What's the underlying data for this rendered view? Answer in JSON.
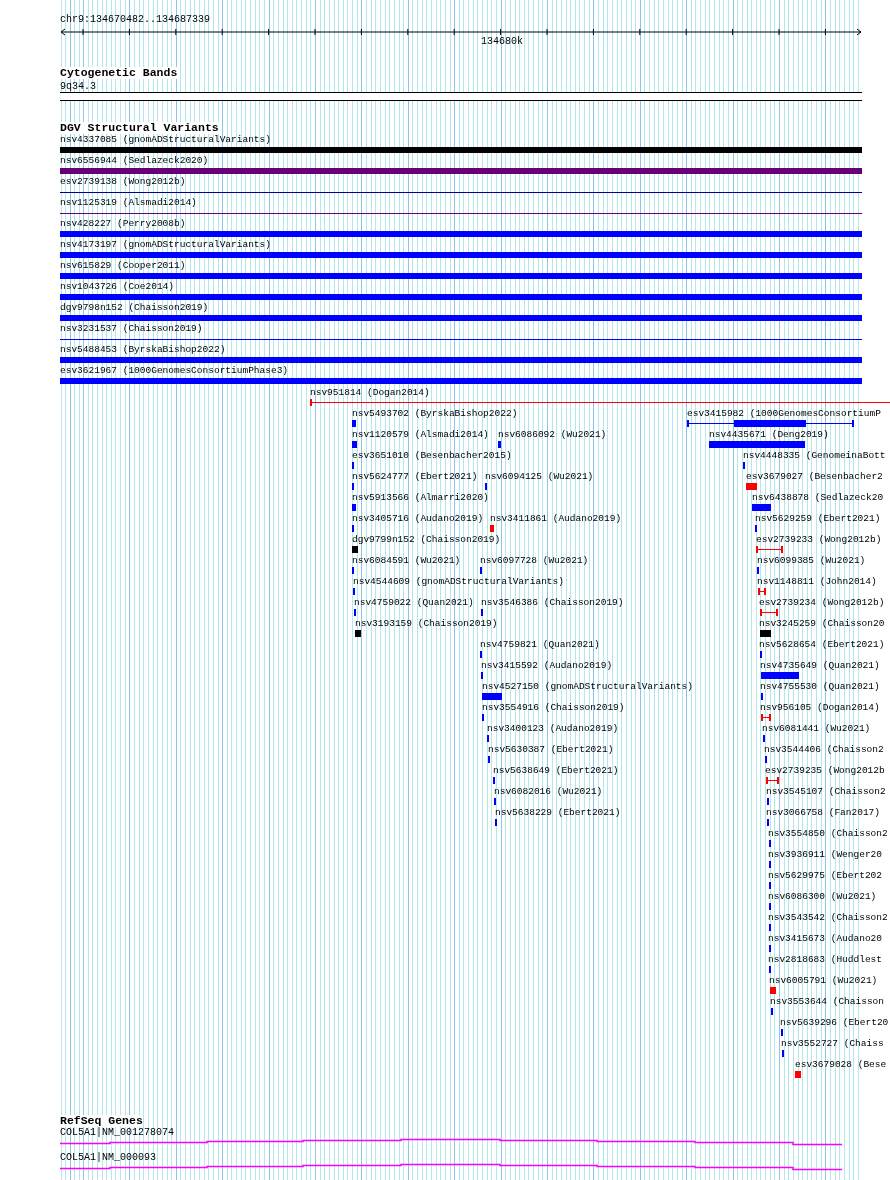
{
  "ruler": {
    "range": "chr9:134670482..134687339",
    "tick_label": "134680k"
  },
  "cytogenetic_bands": {
    "title": "Cytogenetic Bands",
    "band": "9q34.3"
  },
  "dgv": {
    "title": "DGV Structural Variants",
    "full_width": [
      {
        "label": "nsv4337085 (gnomADStructuralVariants)",
        "color": "#000000",
        "kind": "thick"
      },
      {
        "label": "nsv6556944 (Sedlazeck2020)",
        "color": "#660077",
        "kind": "thick"
      },
      {
        "label": "esv2739138 (Wong2012b)",
        "color": "#000099",
        "kind": "thin"
      },
      {
        "label": "nsv1125319 (Alsmadi2014)",
        "color": "#660077",
        "kind": "thin"
      },
      {
        "label": "nsv428227 (Perry2008b)",
        "color": "#0000ff",
        "kind": "thick"
      },
      {
        "label": "nsv4173197 (gnomADStructuralVariants)",
        "color": "#0000ff",
        "kind": "thick"
      },
      {
        "label": "nsv615829 (Cooper2011)",
        "color": "#0000ff",
        "kind": "thick"
      },
      {
        "label": "nsv1043726 (Coe2014)",
        "color": "#0000ff",
        "kind": "thick"
      },
      {
        "label": "dgv9798n152 (Chaisson2019)",
        "color": "#0000ff",
        "kind": "thick"
      },
      {
        "label": "nsv3231537 (Chaisson2019)",
        "color": "#0000ff",
        "kind": "thin"
      },
      {
        "label": "nsv5488453 (ByrskaBishop2022)",
        "color": "#0000ff",
        "kind": "thick"
      },
      {
        "label": "esv3621967 (1000GenomesConsortiumPhase3)",
        "color": "#0000ff",
        "kind": "thick"
      }
    ],
    "variants": [
      {
        "label": "nsv951814 (Dogan2014)",
        "color": "#ff0000",
        "kind": "span"
      },
      {
        "label": "nsv5493702 (ByrskaBishop2022)",
        "color": "#0000ff",
        "kind": "block"
      },
      {
        "label": "nsv1120579 (Alsmadi2014)",
        "color": "#0000ff",
        "kind": "block"
      },
      {
        "label": "nsv6086092 (Wu2021)",
        "color": "#0000ff",
        "kind": "block"
      },
      {
        "label": "esv3651010 (Besenbacher2015)",
        "color": "#0000ff",
        "kind": "block"
      },
      {
        "label": "nsv5624777 (Ebert2021)",
        "color": "#0000ff",
        "kind": "block"
      },
      {
        "label": "nsv6094125 (Wu2021)",
        "color": "#0000ff",
        "kind": "block"
      },
      {
        "label": "nsv5913566 (Almarri2020)",
        "color": "#0000ff",
        "kind": "block"
      },
      {
        "label": "nsv3405716 (Audano2019)",
        "color": "#0000ff",
        "kind": "block"
      },
      {
        "label": "nsv3411861 (Audano2019)",
        "color": "#ff0000",
        "kind": "block"
      },
      {
        "label": "dgv9799n152 (Chaisson2019)",
        "color": "#000000",
        "kind": "block"
      },
      {
        "label": "nsv6084591 (Wu2021)",
        "color": "#0000ff",
        "kind": "block"
      },
      {
        "label": "nsv6097728 (Wu2021)",
        "color": "#0000ff",
        "kind": "block"
      },
      {
        "label": "nsv4544609 (gnomADStructuralVariants)",
        "color": "#0000ff",
        "kind": "block"
      },
      {
        "label": "nsv4759022 (Quan2021)",
        "color": "#0000ff",
        "kind": "block"
      },
      {
        "label": "nsv3546386 (Chaisson2019)",
        "color": "#0000ff",
        "kind": "block"
      },
      {
        "label": "nsv3193159 (Chaisson2019)",
        "color": "#000000",
        "kind": "block"
      },
      {
        "label": "nsv4759821 (Quan2021)",
        "color": "#0000ff",
        "kind": "block"
      },
      {
        "label": "nsv3415592 (Audano2019)",
        "color": "#0000ff",
        "kind": "block"
      },
      {
        "label": "nsv4527150 (gnomADStructuralVariants)",
        "color": "#0000ff",
        "kind": "block"
      },
      {
        "label": "nsv3554916 (Chaisson2019)",
        "color": "#0000ff",
        "kind": "block"
      },
      {
        "label": "nsv3400123 (Audano2019)",
        "color": "#0000ff",
        "kind": "block"
      },
      {
        "label": "nsv5630387 (Ebert2021)",
        "color": "#0000ff",
        "kind": "block"
      },
      {
        "label": "nsv5638649 (Ebert2021)",
        "color": "#0000ff",
        "kind": "block"
      },
      {
        "label": "nsv6082016 (Wu2021)",
        "color": "#0000ff",
        "kind": "block"
      },
      {
        "label": "nsv5638229 (Ebert2021)",
        "color": "#0000ff",
        "kind": "block"
      },
      {
        "label": "esv3415982 (1000GenomesConsortiumP",
        "color": "#0000ff",
        "kind": "gapped"
      },
      {
        "label": "nsv4435671 (Deng2019)",
        "color": "#0000ff",
        "kind": "block"
      },
      {
        "label": "nsv4448335 (GenomeinaBott",
        "color": "#0000ff",
        "kind": "block"
      },
      {
        "label": "esv3679027 (Besenbacher2",
        "color": "#ff0000",
        "kind": "block"
      },
      {
        "label": "nsv6438878 (Sedlazeck20",
        "color": "#0000ff",
        "kind": "block"
      },
      {
        "label": "nsv5629259 (Ebert2021)",
        "color": "#0000ff",
        "kind": "block"
      },
      {
        "label": "esv2739233 (Wong2012b)",
        "color": "#ff0000",
        "kind": "span"
      },
      {
        "label": "nsv6099385 (Wu2021)",
        "color": "#0000ff",
        "kind": "block"
      },
      {
        "label": "nsv1148811 (John2014)",
        "color": "#ff0000",
        "kind": "span"
      },
      {
        "label": "esv2739234 (Wong2012b)",
        "color": "#ff0000",
        "kind": "span"
      },
      {
        "label": "nsv3245259 (Chaisson20",
        "color": "#000000",
        "kind": "block"
      },
      {
        "label": "nsv5628654 (Ebert2021)",
        "color": "#0000ff",
        "kind": "block"
      },
      {
        "label": "nsv4735649 (Quan2021)",
        "color": "#0000ff",
        "kind": "block"
      },
      {
        "label": "nsv4755530 (Quan2021)",
        "color": "#0000ff",
        "kind": "block"
      },
      {
        "label": "nsv956105 (Dogan2014)",
        "color": "#ff0000",
        "kind": "span"
      },
      {
        "label": "nsv6081441 (Wu2021)",
        "color": "#0000ff",
        "kind": "block"
      },
      {
        "label": "nsv3544406 (Chaisson2",
        "color": "#0000ff",
        "kind": "block"
      },
      {
        "label": "esv2739235 (Wong2012b",
        "color": "#ff0000",
        "kind": "span"
      },
      {
        "label": "nsv3545107 (Chaisson2",
        "color": "#0000ff",
        "kind": "block"
      },
      {
        "label": "nsv3066758 (Fan2017)",
        "color": "#0000ff",
        "kind": "block"
      },
      {
        "label": "nsv3554850 (Chaisson2",
        "color": "#0000ff",
        "kind": "block"
      },
      {
        "label": "nsv3936911 (Wenger20",
        "color": "#0000ff",
        "kind": "block"
      },
      {
        "label": "nsv5629975 (Ebert202",
        "color": "#0000ff",
        "kind": "block"
      },
      {
        "label": "nsv6086300 (Wu2021)",
        "color": "#0000ff",
        "kind": "block"
      },
      {
        "label": "nsv3543542 (Chaisson2",
        "color": "#0000ff",
        "kind": "block"
      },
      {
        "label": "nsv3415673 (Audano20",
        "color": "#0000ff",
        "kind": "block"
      },
      {
        "label": "nsv2818683 (Huddlest",
        "color": "#0000ff",
        "kind": "block"
      },
      {
        "label": "nsv6005791 (Wu2021)",
        "color": "#ff0000",
        "kind": "block"
      },
      {
        "label": "nsv3553644 (Chaisson",
        "color": "#0000ff",
        "kind": "block"
      },
      {
        "label": "nsv5639296 (Ebert20",
        "color": "#0000ff",
        "kind": "block"
      },
      {
        "label": "nsv3552727 (Chaiss",
        "color": "#0000ff",
        "kind": "block"
      },
      {
        "label": "esv3679028 (Bese",
        "color": "#ff0000",
        "kind": "block"
      }
    ]
  },
  "refseq": {
    "title": "RefSeq Genes",
    "transcripts": [
      {
        "label": "COL5A1|NM_001278074"
      },
      {
        "label": "COL5A1|NM_000093"
      }
    ]
  }
}
